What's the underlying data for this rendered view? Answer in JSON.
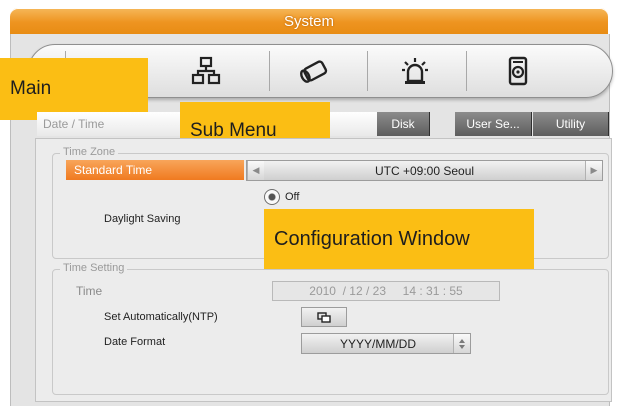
{
  "window": {
    "title": "System"
  },
  "toolbar": {
    "icons": [
      "monitor-icon",
      "network-icon",
      "camera-icon",
      "alarm-icon",
      "disk-icon"
    ]
  },
  "annotations": {
    "main": "Main",
    "sub_menu": "Sub Menu",
    "configuration_window": "Configuration Window"
  },
  "tabs": {
    "date_time": "Date / Time",
    "disk": "Disk",
    "user_settings": "User Se...",
    "utility": "Utility"
  },
  "time_zone": {
    "legend": "Time Zone",
    "standard_time_label": "Standard Time",
    "standard_time_value": "UTC +09:00 Seoul",
    "daylight_saving_label": "Daylight Saving",
    "daylight_option_off": "Off"
  },
  "time_setting": {
    "legend": "Time Setting",
    "time_label": "Time",
    "time_value": "2010  / 12 / 23     14 : 31 : 55",
    "ntp_label": "Set Automatically(NTP)",
    "date_format_label": "Date Format",
    "date_format_value": "YYYY/MM/DD"
  },
  "colors": {
    "title_orange": "#ee9420",
    "callout_yellow": "#fbbe14",
    "selected_orange": "#f07a20"
  }
}
